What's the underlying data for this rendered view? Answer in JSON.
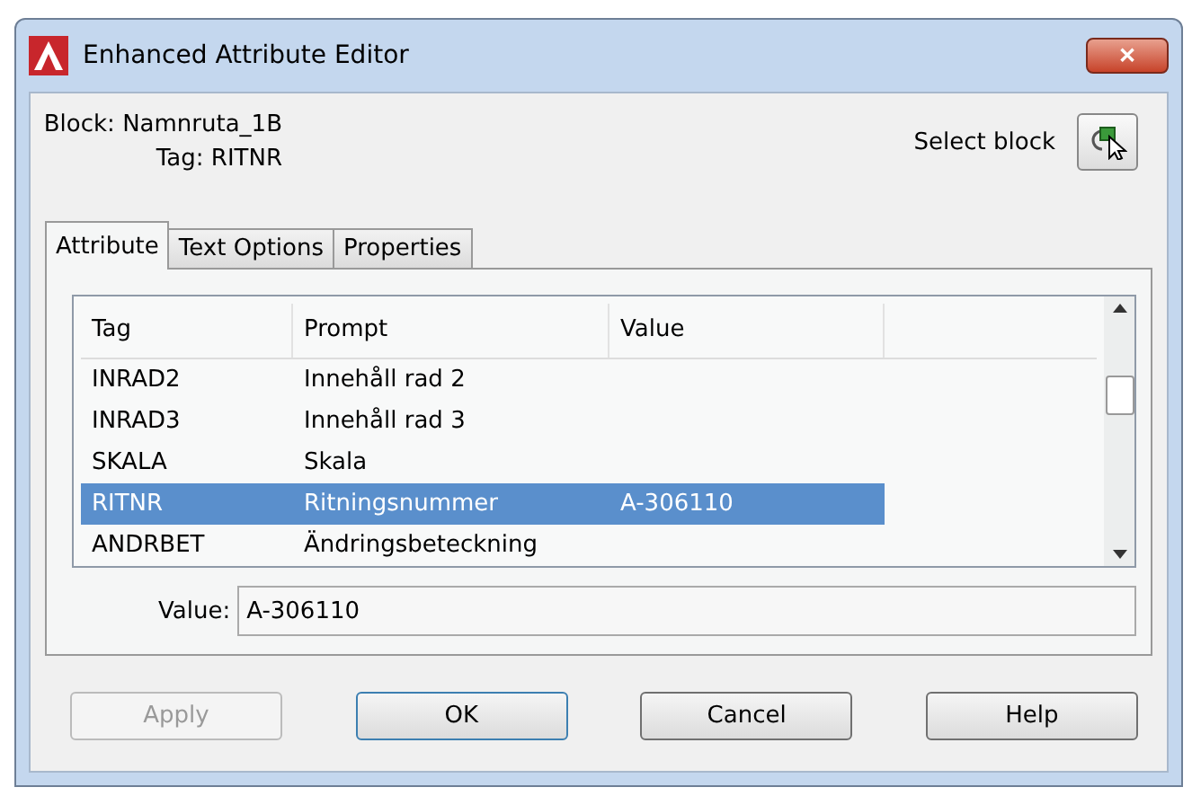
{
  "window": {
    "title": "Enhanced Attribute Editor",
    "close": "✕"
  },
  "block": {
    "label": "Block:",
    "value": "Namnruta_1B"
  },
  "tag": {
    "label": "Tag:",
    "value": "RITNR"
  },
  "select_block": {
    "label": "Select block"
  },
  "tabs": [
    {
      "label": "Attribute",
      "selected": true
    },
    {
      "label": "Text Options",
      "selected": false
    },
    {
      "label": "Properties",
      "selected": false
    }
  ],
  "table": {
    "columns": [
      "Tag",
      "Prompt",
      "Value"
    ],
    "rows": [
      {
        "tag": "INRAD2",
        "prompt": "Innehåll rad 2",
        "value": "",
        "selected": false
      },
      {
        "tag": "INRAD3",
        "prompt": "Innehåll rad 3",
        "value": "",
        "selected": false
      },
      {
        "tag": "SKALA",
        "prompt": "Skala",
        "value": "",
        "selected": false
      },
      {
        "tag": "RITNR",
        "prompt": "Ritningsnummer",
        "value": "A-306110",
        "selected": true
      },
      {
        "tag": "ANDRBET",
        "prompt": "Ändringsbeteckning",
        "value": "",
        "selected": false
      }
    ]
  },
  "value_field": {
    "label": "Value:",
    "value": "A-306110"
  },
  "buttons": [
    {
      "label": "Apply",
      "disabled": true,
      "default": false
    },
    {
      "label": "OK",
      "disabled": false,
      "default": true
    },
    {
      "label": "Cancel",
      "disabled": false,
      "default": false
    },
    {
      "label": "Help",
      "disabled": false,
      "default": false
    }
  ]
}
